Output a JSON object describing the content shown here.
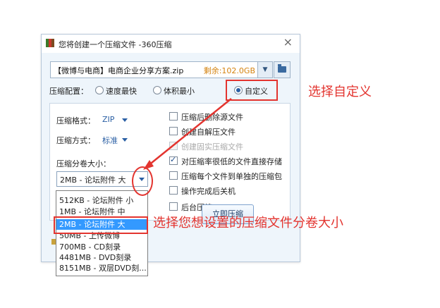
{
  "window": {
    "title": "您将创建一个压缩文件 -360压缩",
    "close_glyph": "×"
  },
  "archive": {
    "path": "【微博与电商】电商企业分享方案.zip",
    "free_space": "剩余:102.0GB",
    "dropdown_glyph": "▼"
  },
  "compress_config": {
    "label": "压缩配置：",
    "options": [
      "速度最快",
      "体积最小",
      "自定义"
    ],
    "selected": "自定义"
  },
  "format": {
    "label": "压缩格式：",
    "value": "ZIP"
  },
  "method": {
    "label": "压缩方式：",
    "value": "标准"
  },
  "split": {
    "label": "压缩分卷大小：",
    "current_value": "2MB   - 论坛附件 大",
    "options": [
      "512KB  - 论坛附件 小",
      "1MB    - 论坛附件 中",
      "2MB    - 论坛附件 大",
      "50MB   - 上传微博",
      "700MB  - CD刻录",
      "4481MB - DVD刻录",
      "8151MB - 双层DVD刻..."
    ],
    "selected_index": 2
  },
  "checkboxes": [
    {
      "label": "压缩后删除源文件",
      "checked": false,
      "disabled": false
    },
    {
      "label": "创建自解压文件",
      "checked": false,
      "disabled": false
    },
    {
      "label": "创建固实压缩文件",
      "checked": false,
      "disabled": true
    },
    {
      "label": "对压缩率很低的文件直接存储",
      "checked": true,
      "disabled": false
    },
    {
      "label": "压缩每个文件到单独的压缩包",
      "checked": false,
      "disabled": false
    },
    {
      "label": "操作完成后关机",
      "checked": false,
      "disabled": false
    },
    {
      "label": "后台压缩",
      "checked": false,
      "disabled": false
    }
  ],
  "compress_button": "立即压缩",
  "annotations": {
    "custom": "选择自定义",
    "split": "选择您想设置的压缩文件分卷大小"
  },
  "colors": {
    "annotation_red": "#e3342f",
    "accent_blue": "#2a5fa4",
    "free_space_orange": "#d4820e",
    "selection_blue": "#3399ff"
  }
}
